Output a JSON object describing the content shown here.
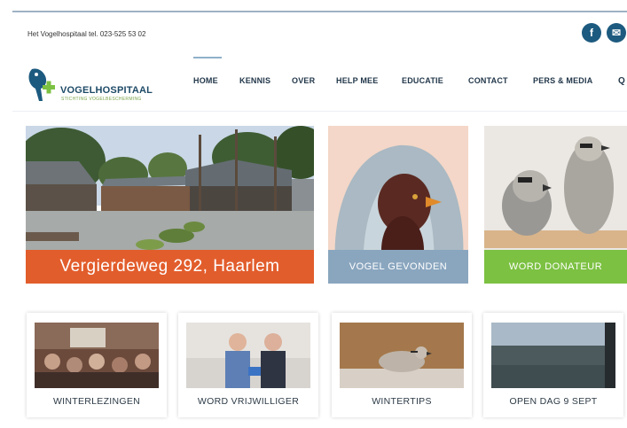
{
  "header": {
    "contact_text": "Het Vogelhospitaal tel. 023-525 53 02",
    "social": [
      {
        "name": "facebook",
        "glyph": "f"
      },
      {
        "name": "email",
        "glyph": "✉"
      }
    ]
  },
  "logo": {
    "title": "VOGELHOSPITAAL",
    "subtitle": "STICHTING VOGELBESCHERMING"
  },
  "nav": {
    "items": [
      "HOME",
      "KENNIS",
      "OVER",
      "HELP MEE",
      "EDUCATIE",
      "CONTACT",
      "PERS & MEDIA"
    ],
    "active": "HOME",
    "search_glyph": "Q"
  },
  "hero": {
    "address_label": "Vergierdeweg 292, Haarlem",
    "found_bird_label": "VOGEL GEVONDEN",
    "donate_label": "WORD DONATEUR"
  },
  "cards": [
    {
      "label": "WINTERLEZINGEN"
    },
    {
      "label": "WORD VRIJWILLIGER"
    },
    {
      "label": "WINTERTIPS"
    },
    {
      "label": "OPEN DAG 9 SEPT"
    }
  ],
  "colors": {
    "brand_blue": "#1d5a7f",
    "orange": "#e25d2c",
    "slate_blue": "#8aa6bf",
    "green": "#7cc142"
  }
}
